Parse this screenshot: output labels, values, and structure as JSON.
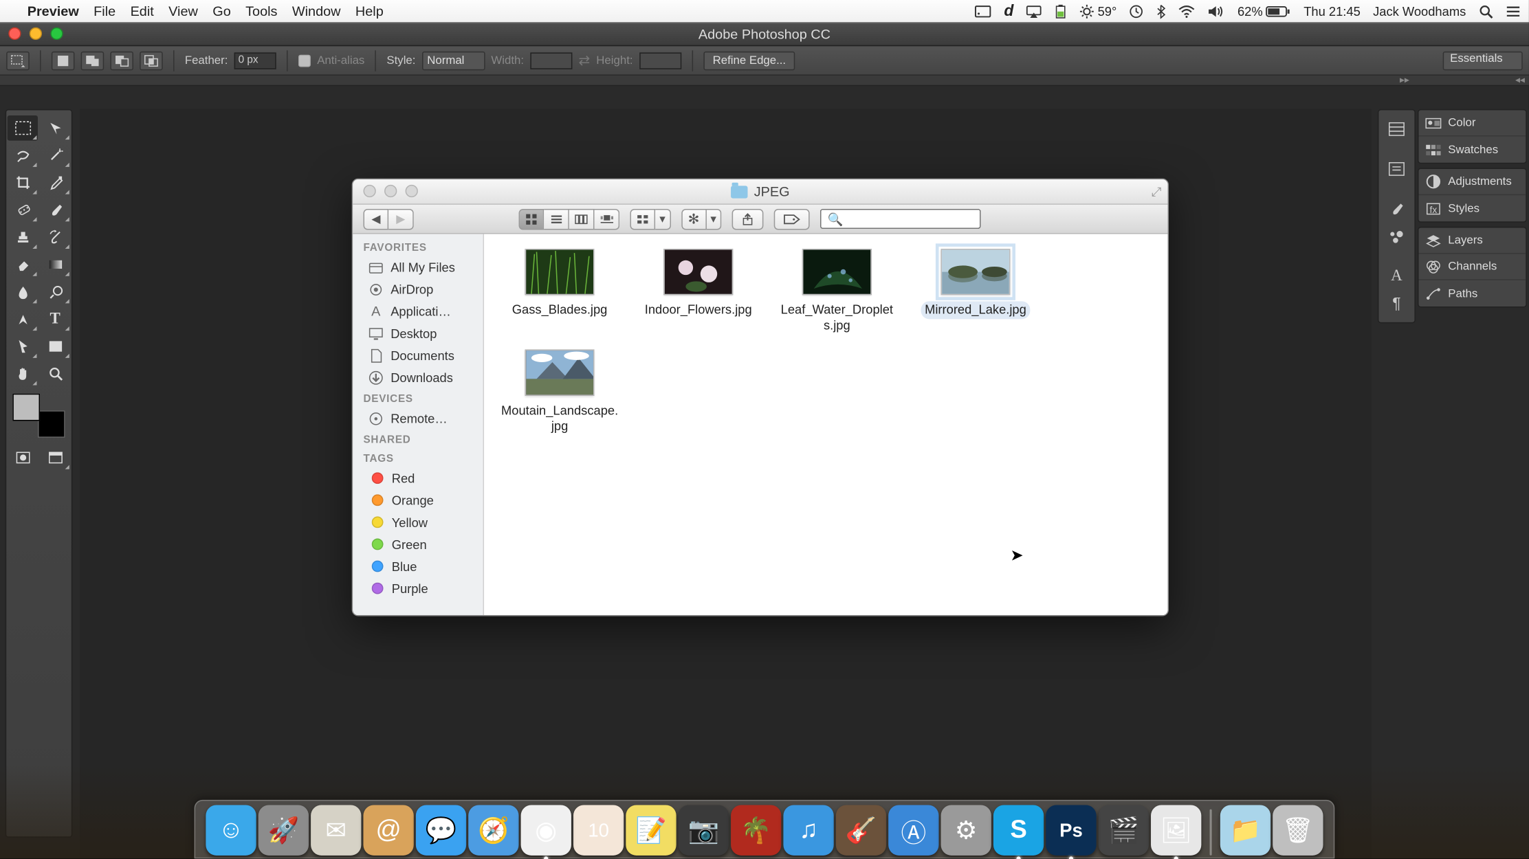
{
  "menubar": {
    "app_name": "Preview",
    "items": [
      "File",
      "Edit",
      "View",
      "Go",
      "Tools",
      "Window",
      "Help"
    ],
    "right": {
      "temp": "59°",
      "battery": "62%",
      "clock": "Thu 21:45",
      "user": "Jack Woodhams"
    }
  },
  "photoshop": {
    "title": "Adobe Photoshop CC",
    "options": {
      "feather_label": "Feather:",
      "feather_value": "0 px",
      "antialias_label": "Anti-alias",
      "style_label": "Style:",
      "style_value": "Normal",
      "width_label": "Width:",
      "height_label": "Height:",
      "refine_label": "Refine Edge...",
      "workspace": "Essentials"
    },
    "panels": {
      "color": "Color",
      "swatches": "Swatches",
      "adjustments": "Adjustments",
      "styles": "Styles",
      "layers": "Layers",
      "channels": "Channels",
      "paths": "Paths"
    }
  },
  "finder": {
    "title": "JPEG",
    "sidebar": {
      "favorites_header": "FAVORITES",
      "favorites": [
        {
          "label": "All My Files",
          "icon": "all-files"
        },
        {
          "label": "AirDrop",
          "icon": "airdrop"
        },
        {
          "label": "Applicati…",
          "icon": "applications"
        },
        {
          "label": "Desktop",
          "icon": "desktop"
        },
        {
          "label": "Documents",
          "icon": "documents"
        },
        {
          "label": "Downloads",
          "icon": "downloads"
        }
      ],
      "devices_header": "DEVICES",
      "devices": [
        {
          "label": "Remote…",
          "icon": "remote-disc"
        }
      ],
      "shared_header": "SHARED",
      "tags_header": "TAGS",
      "tags": [
        {
          "label": "Red",
          "color": "#ff4f44"
        },
        {
          "label": "Orange",
          "color": "#ff9a2e"
        },
        {
          "label": "Yellow",
          "color": "#f7d935"
        },
        {
          "label": "Green",
          "color": "#7ed94b"
        },
        {
          "label": "Blue",
          "color": "#3fa3ff"
        },
        {
          "label": "Purple",
          "color": "#b06be6"
        }
      ]
    },
    "files": [
      {
        "name": "Gass_Blades.jpg",
        "selected": false,
        "thumb": "grass"
      },
      {
        "name": "Indoor_Flowers.jpg",
        "selected": false,
        "thumb": "flowers"
      },
      {
        "name": "Leaf_Water_Droplets.jpg",
        "selected": false,
        "thumb": "leaf"
      },
      {
        "name": "Mirrored_Lake.jpg",
        "selected": true,
        "thumb": "lake"
      },
      {
        "name": "Moutain_Landscape.jpg",
        "selected": false,
        "thumb": "mountain"
      }
    ],
    "search_placeholder": ""
  },
  "dock": {
    "apps": [
      {
        "name": "Finder",
        "color": "#3aa8ea",
        "glyph": "☺"
      },
      {
        "name": "Launchpad",
        "color": "#8c8c8c",
        "glyph": "🚀"
      },
      {
        "name": "Mail",
        "color": "#d6d2c6",
        "glyph": "✉"
      },
      {
        "name": "Contacts",
        "color": "#d9a35b",
        "glyph": "@"
      },
      {
        "name": "Messages",
        "color": "#3aa2f1",
        "glyph": "💬"
      },
      {
        "name": "Safari",
        "color": "#4c9ce2",
        "glyph": "🧭"
      },
      {
        "name": "Chrome",
        "color": "#f0f0f0",
        "glyph": "◉",
        "ind": true
      },
      {
        "name": "Calendar",
        "color": "#f4e6d8",
        "glyph": "10"
      },
      {
        "name": "Notes",
        "color": "#f2dd63",
        "glyph": "📝"
      },
      {
        "name": "PhotoBooth",
        "color": "#3a3a3a",
        "glyph": "📷"
      },
      {
        "name": "iPhoto",
        "color": "#b12a1e",
        "glyph": "🌴"
      },
      {
        "name": "iTunes",
        "color": "#3a97e0",
        "glyph": "♫"
      },
      {
        "name": "GarageBand",
        "color": "#6b523b",
        "glyph": "🎸"
      },
      {
        "name": "AppStore",
        "color": "#3a88d8",
        "glyph": "Ⓐ"
      },
      {
        "name": "SystemPrefs",
        "color": "#9a9a9a",
        "glyph": "⚙"
      },
      {
        "name": "Skype",
        "color": "#1aa4e4",
        "glyph": "S",
        "ind": true
      },
      {
        "name": "Photoshop",
        "color": "#0b2e54",
        "glyph": "Ps",
        "ind": true
      },
      {
        "name": "iMovie",
        "color": "#444",
        "glyph": "🎬"
      },
      {
        "name": "Preview",
        "color": "#e7e7e7",
        "glyph": "🖼",
        "ind": true
      }
    ],
    "right": [
      {
        "name": "Downloads",
        "color": "#aad5ea",
        "glyph": "📁"
      },
      {
        "name": "Trash",
        "color": "#bfbfbf",
        "glyph": "🗑"
      }
    ]
  }
}
